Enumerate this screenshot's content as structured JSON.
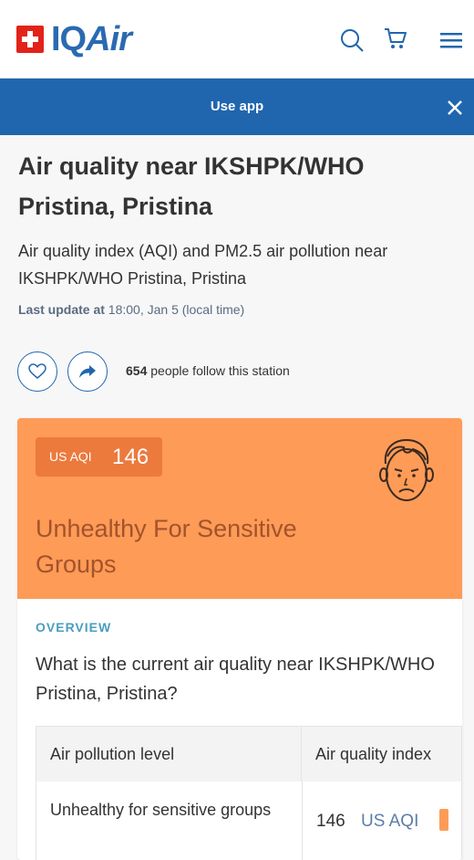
{
  "header": {
    "logo_iq": "IQ",
    "logo_air": "Air"
  },
  "app_banner": {
    "label": "Use app"
  },
  "page": {
    "title": "Air quality near IKSHPK/WHO Pristina, Pristina",
    "subtitle": "Air quality index (AQI) and PM2.5 air pollution near IKSHPK/WHO Pristina, Pristina",
    "last_update_label": "Last update at",
    "last_update_value": "18:00, Jan 5 (local time)",
    "followers_count": "654",
    "followers_text": "people follow this station"
  },
  "aqi_card": {
    "label": "US AQI",
    "value": "146",
    "status": "Unhealthy For Sensitive Groups",
    "color": "#fe9b57",
    "badge_color": "#ec7a3d"
  },
  "overview": {
    "heading": "OVERVIEW",
    "question": "What is the current air quality near IKSHPK/WHO Pristina, Pristina?",
    "table": {
      "headers": [
        "Air pollution level",
        "Air quality index"
      ],
      "rows": [
        {
          "level": "Unhealthy for sensitive groups",
          "value": "146",
          "unit": "US AQI"
        }
      ]
    }
  },
  "colors": {
    "brand_blue": "#2066ae",
    "logo_red": "#e2231a",
    "logo_blue": "#2a6ab1"
  }
}
